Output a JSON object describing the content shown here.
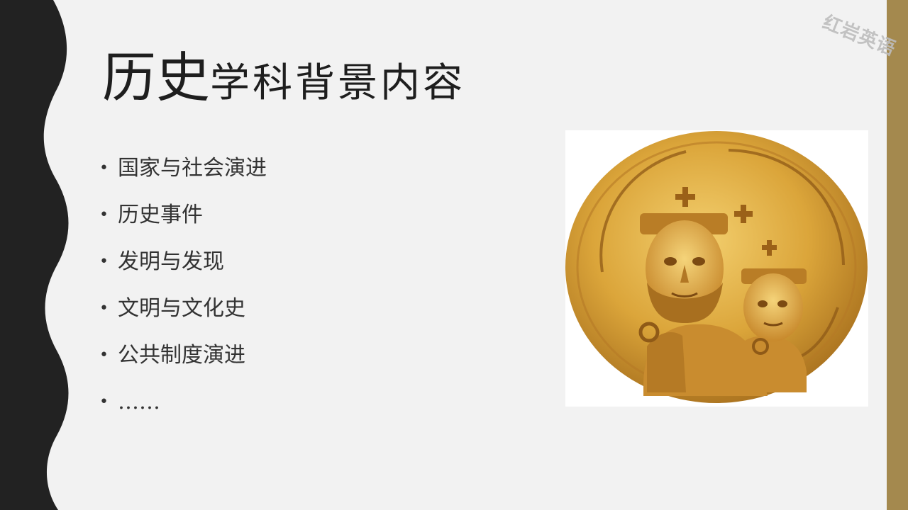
{
  "slide": {
    "title_large": "历史",
    "title_rest": "学科背景内容",
    "bullet_char": "•",
    "bullets": [
      "国家与社会演进",
      "历史事件",
      "发明与发现",
      "文明与文化史",
      "公共制度演进",
      "……"
    ],
    "watermark": "红岩英语",
    "colors": {
      "background": "#f2f2f2",
      "left_band": "#222222",
      "right_band": "#a4894e",
      "coin_gold": "#d9a73c"
    },
    "image": "byzantine-gold-coin"
  }
}
